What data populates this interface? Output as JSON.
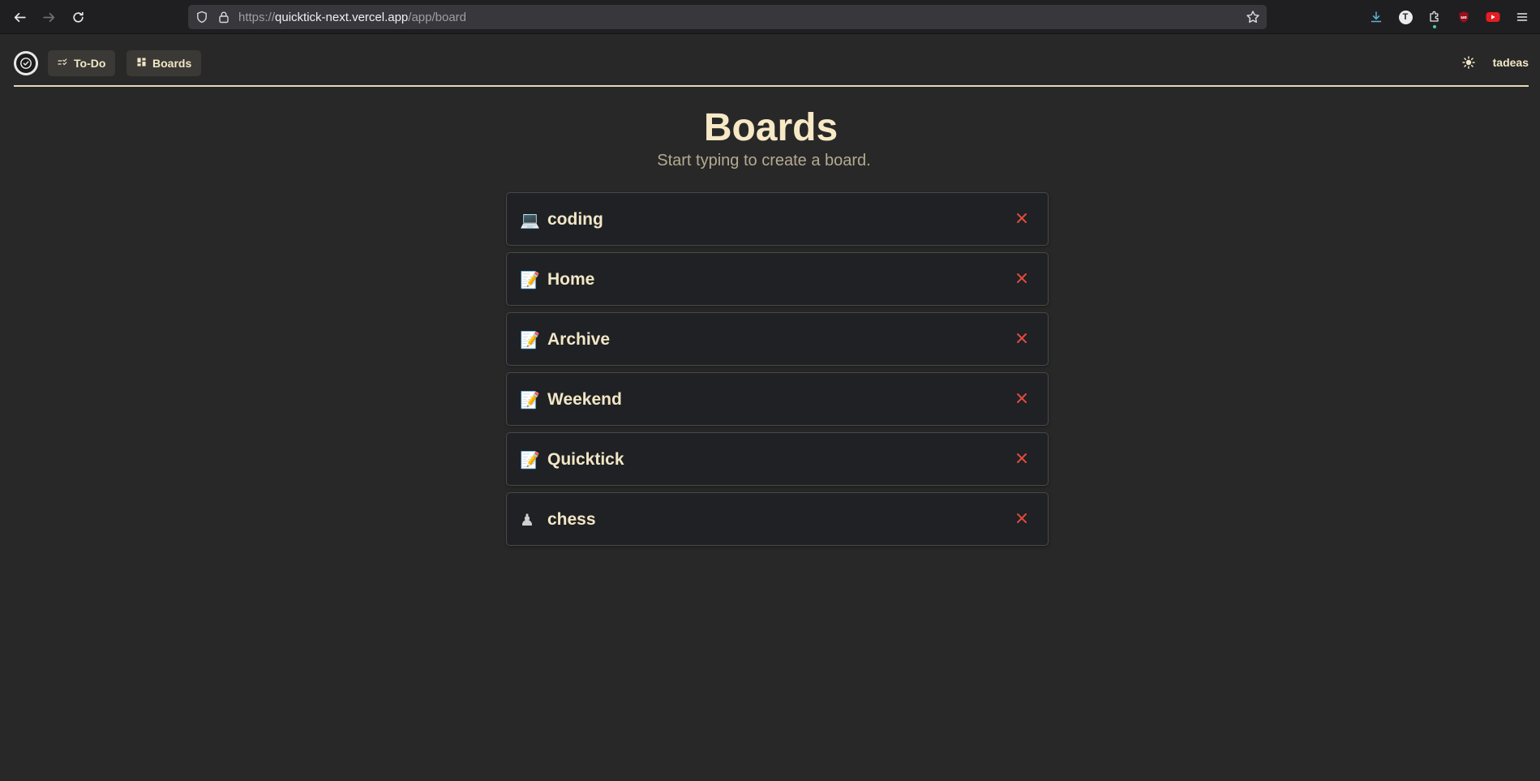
{
  "browser": {
    "url_prefix": "https://",
    "url_domain": "quicktick-next.vercel.app",
    "url_path": "/app/board"
  },
  "header": {
    "nav": [
      {
        "label": "To-Do",
        "icon": "checklist-icon"
      },
      {
        "label": "Boards",
        "icon": "grid-icon"
      }
    ],
    "username": "tadeas"
  },
  "main": {
    "title": "Boards",
    "subtitle": "Start typing to create a board.",
    "boards": [
      {
        "emoji": "💻",
        "name": "coding"
      },
      {
        "emoji": "📝",
        "name": "Home"
      },
      {
        "emoji": "📝",
        "name": "Archive"
      },
      {
        "emoji": "📝",
        "name": "Weekend"
      },
      {
        "emoji": "📝",
        "name": "Quicktick"
      },
      {
        "emoji": "♟",
        "name": "chess"
      }
    ]
  },
  "colors": {
    "background": "#282828",
    "card": "#1f2124",
    "accent_text": "#f2e6c6",
    "delete": "#e04a3f"
  }
}
